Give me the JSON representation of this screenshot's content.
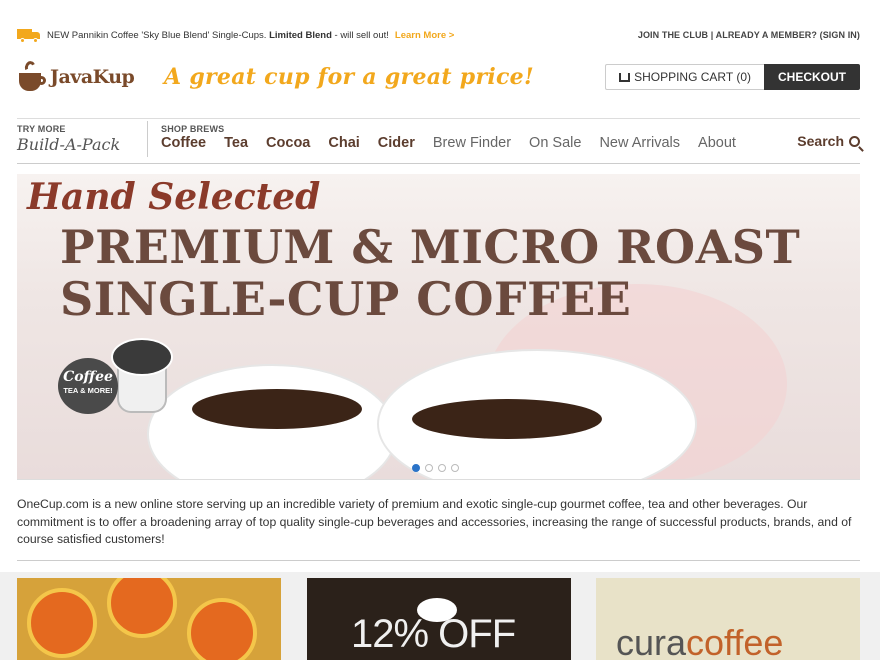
{
  "topbar": {
    "promo_prefix": "NEW Pannikin Coffee 'Sky Blue Blend' Single-Cups. ",
    "promo_bold": "Limited Blend",
    "promo_suffix": " - will sell out!",
    "learn_more": "Learn More >",
    "account": "JOIN THE CLUB | ALREADY A MEMBER? (SIGN IN)"
  },
  "header": {
    "logo": "JavaKup",
    "tagline": "A great cup for a great price!",
    "cart_label": "SHOPPING CART (0)",
    "checkout_label": "CHECKOUT"
  },
  "nav": {
    "try_more": "TRY MORE",
    "build_a_pack": "Build-A-Pack",
    "shop_brews": "SHOP BREWS",
    "bold_links": [
      "Coffee",
      "Tea",
      "Cocoa",
      "Chai",
      "Cider"
    ],
    "links": [
      "Brew Finder",
      "On Sale",
      "New Arrivals",
      "About"
    ],
    "search": "Search"
  },
  "hero": {
    "script": "Hand Selected",
    "line1": "PREMIUM & MICRO ROAST",
    "line2": "SINGLE-CUP COFFEE",
    "badge_title": "Coffee",
    "badge_sub": "TEA & MORE!",
    "slide_count": 4,
    "active_slide": 1
  },
  "intro": "OneCup.com is a new online store serving up an incredible variety of premium and exotic single-cup gourmet coffee, tea and other beverages. Our commitment is to offer a broadening array of top quality single-cup beverages and accessories, increasing the range of successful products, brands, and of course satisfied customers!",
  "promos": {
    "card2_text": "12% OFF",
    "card3_text_a": "cura",
    "card3_text_b": "coffee"
  },
  "colors": {
    "accent": "#f2a81d",
    "brown": "#6b4a3e",
    "dark": "#333333",
    "active_dot": "#2a73c8"
  }
}
